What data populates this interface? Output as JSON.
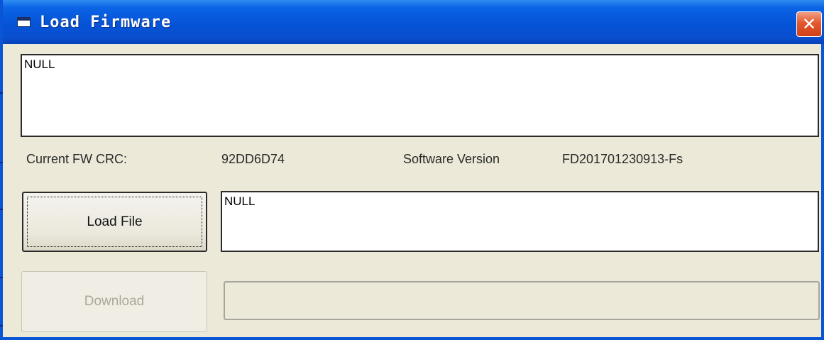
{
  "window": {
    "title": "Load Firmware",
    "close_glyph": "✕"
  },
  "log_box": {
    "text": "NULL"
  },
  "info": {
    "crc_label": "Current FW CRC:",
    "crc_value": "92DD6D74",
    "version_label": "Software Version",
    "version_value": "FD201701230913-Fs"
  },
  "buttons": {
    "load_file_label": "Load File",
    "download_label": "Download"
  },
  "file_box": {
    "text": "NULL"
  },
  "progress": {
    "value": 0
  },
  "icons": {
    "window_icon": "window-icon",
    "close_icon": "close-icon"
  },
  "colors": {
    "titlebar": "#0553d6",
    "close_button": "#e2592e",
    "dialog_background": "#ece9d8",
    "disabled_text": "#aca899"
  }
}
